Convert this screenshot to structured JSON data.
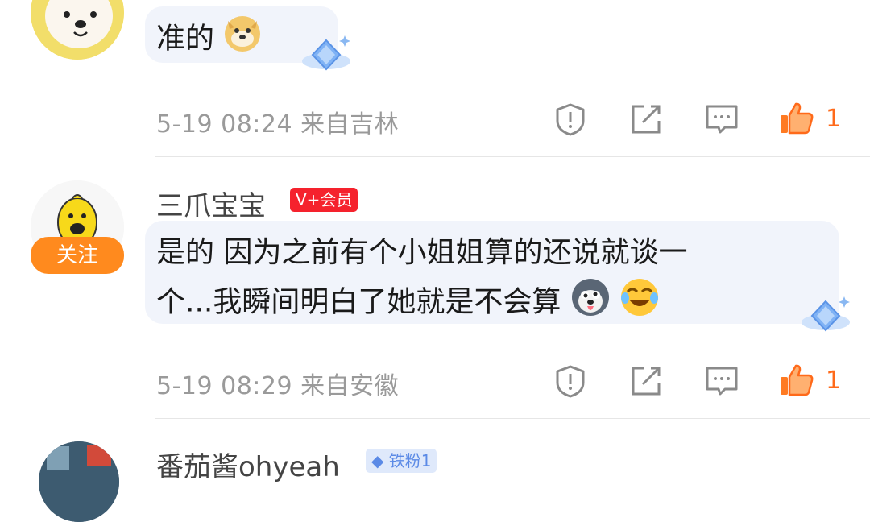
{
  "comments": [
    {
      "text": "准的",
      "meta": "5-19 08:24 来自吉林",
      "likes": "1"
    },
    {
      "username": "三爪宝宝",
      "badge": "V+会员",
      "follow_label": "关注",
      "text_line1": "是的 因为之前有个小姐姐算的还说就谈一",
      "text_line2": "个...我瞬间明白了她就是不会算",
      "meta": "5-19 08:29 来自安徽",
      "likes": "1"
    },
    {
      "username": "番茄酱ohyeah",
      "badge": "铁粉1"
    }
  ],
  "icons": [
    "report-icon",
    "share-icon",
    "reply-icon",
    "like-icon"
  ],
  "colors": {
    "accent": "#ff6a1a",
    "vip": "#f5222d",
    "follow": "#ff8a1e",
    "bubble": "#f1f4fb"
  }
}
